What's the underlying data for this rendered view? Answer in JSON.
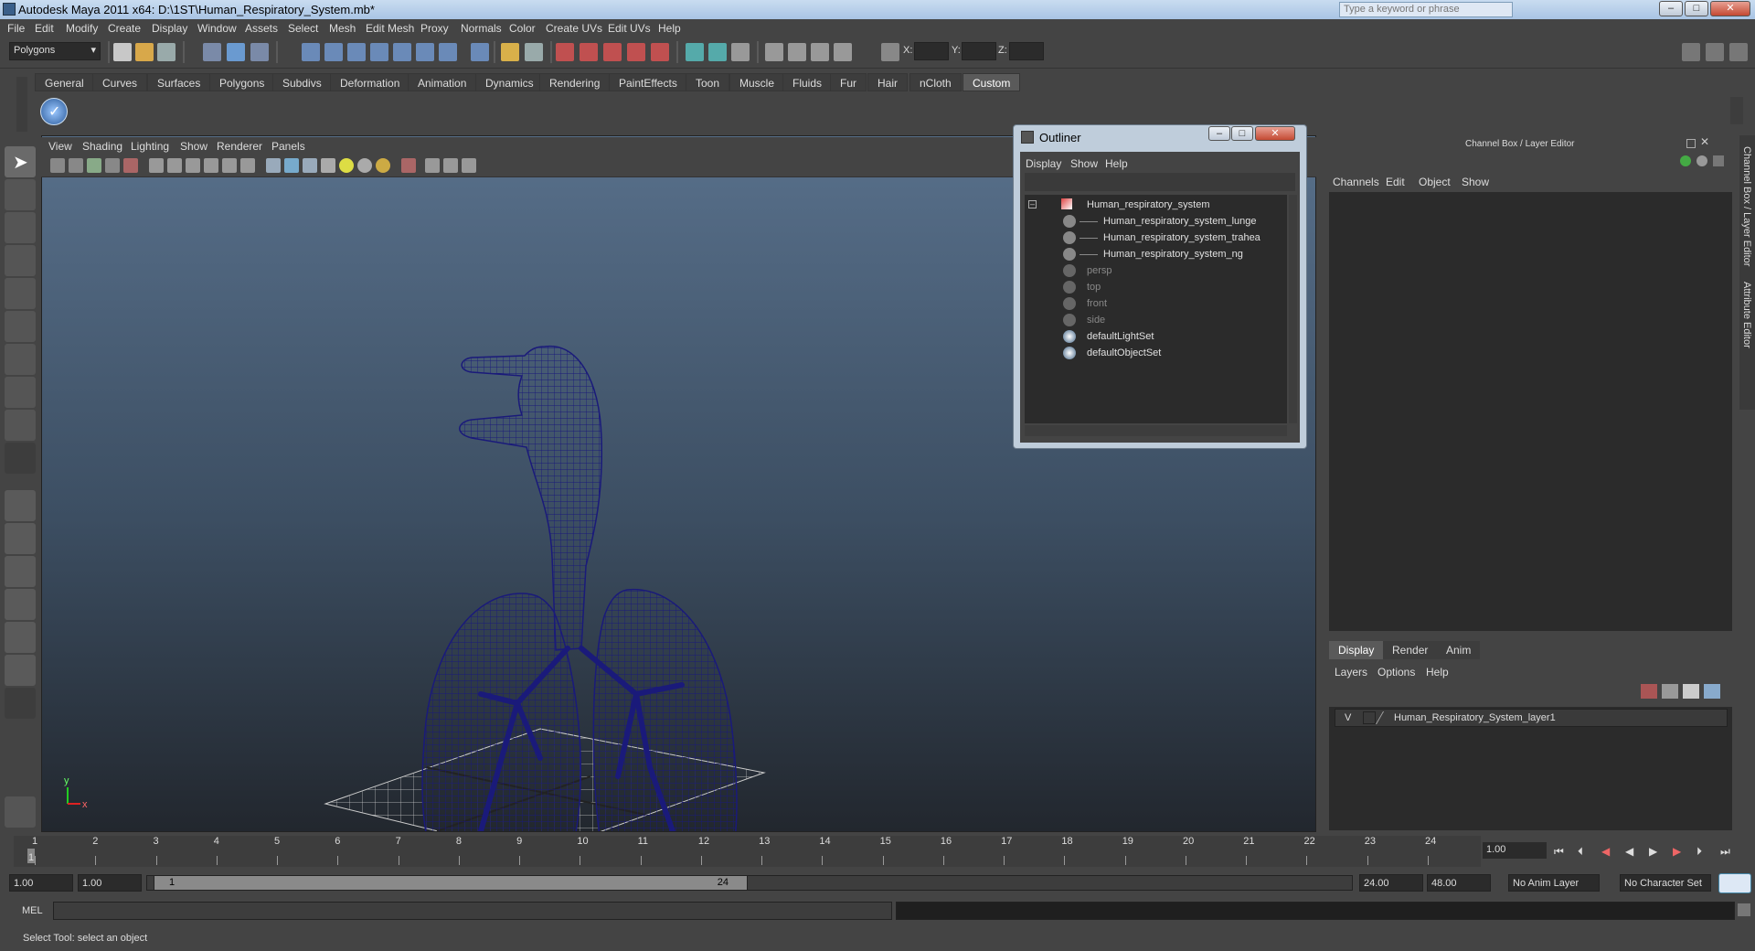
{
  "window": {
    "title": "Autodesk Maya 2011 x64: D:\\1ST\\Human_Respiratory_System.mb*",
    "search_placeholder": "Type a keyword or phrase"
  },
  "menubar": [
    "File",
    "Edit",
    "Modify",
    "Create",
    "Display",
    "Window",
    "Assets",
    "Select",
    "Mesh",
    "Edit Mesh",
    "Proxy",
    "Normals",
    "Color",
    "Create UVs",
    "Edit UVs",
    "Help"
  ],
  "status_line": {
    "mode": "Polygons",
    "x_label": "X:",
    "y_label": "Y:",
    "z_label": "Z:"
  },
  "shelf_tabs": [
    "General",
    "Curves",
    "Surfaces",
    "Polygons",
    "Subdivs",
    "Deformation",
    "Animation",
    "Dynamics",
    "Rendering",
    "PaintEffects",
    "Toon",
    "Muscle",
    "Fluids",
    "Fur",
    "Hair",
    "nCloth",
    "Custom"
  ],
  "active_shelf_tab": "Custom",
  "viewport": {
    "menu": [
      "View",
      "Shading",
      "Lighting",
      "Show",
      "Renderer",
      "Panels"
    ],
    "axis_y": "y",
    "axis_x": "x"
  },
  "outliner": {
    "title": "Outliner",
    "menu": [
      "Display",
      "Show",
      "Help"
    ],
    "items": [
      {
        "label": "Human_respiratory_system"
      },
      {
        "label": "Human_respiratory_system_lunge"
      },
      {
        "label": "Human_respiratory_system_trahea"
      },
      {
        "label": "Human_respiratory_system_ng"
      },
      {
        "label": "persp"
      },
      {
        "label": "top"
      },
      {
        "label": "front"
      },
      {
        "label": "side"
      },
      {
        "label": "defaultLightSet"
      },
      {
        "label": "defaultObjectSet"
      }
    ]
  },
  "channel_box": {
    "title": "Channel Box / Layer Editor",
    "menu": [
      "Channels",
      "Edit",
      "Object",
      "Show"
    ],
    "layer_tabs": [
      "Display",
      "Render",
      "Anim"
    ],
    "active_layer_tab": "Display",
    "layer_menu": [
      "Layers",
      "Options",
      "Help"
    ],
    "layer": {
      "visibility": "V",
      "name": "Human_Respiratory_System_layer1"
    },
    "side_tabs": [
      "Channel Box / Layer Editor",
      "Attribute Editor"
    ]
  },
  "timeline": {
    "ticks": [
      "1",
      "2",
      "3",
      "4",
      "5",
      "6",
      "7",
      "8",
      "9",
      "10",
      "11",
      "12",
      "13",
      "14",
      "15",
      "16",
      "17",
      "18",
      "19",
      "20",
      "21",
      "22",
      "23",
      "24"
    ],
    "current_frame": "1",
    "current_time": "1.00"
  },
  "range": {
    "start": "1.00",
    "playback_start": "1.00",
    "slider_start": "1",
    "slider_end": "24",
    "playback_end": "24.00",
    "end": "48.00",
    "anim_layer": "No Anim Layer",
    "character_set": "No Character Set"
  },
  "command_line": {
    "label": "MEL"
  },
  "help_line": "Select Tool: select an object",
  "colors": {
    "wire": "#1a1a7a",
    "accent": "#5a5a5a"
  }
}
